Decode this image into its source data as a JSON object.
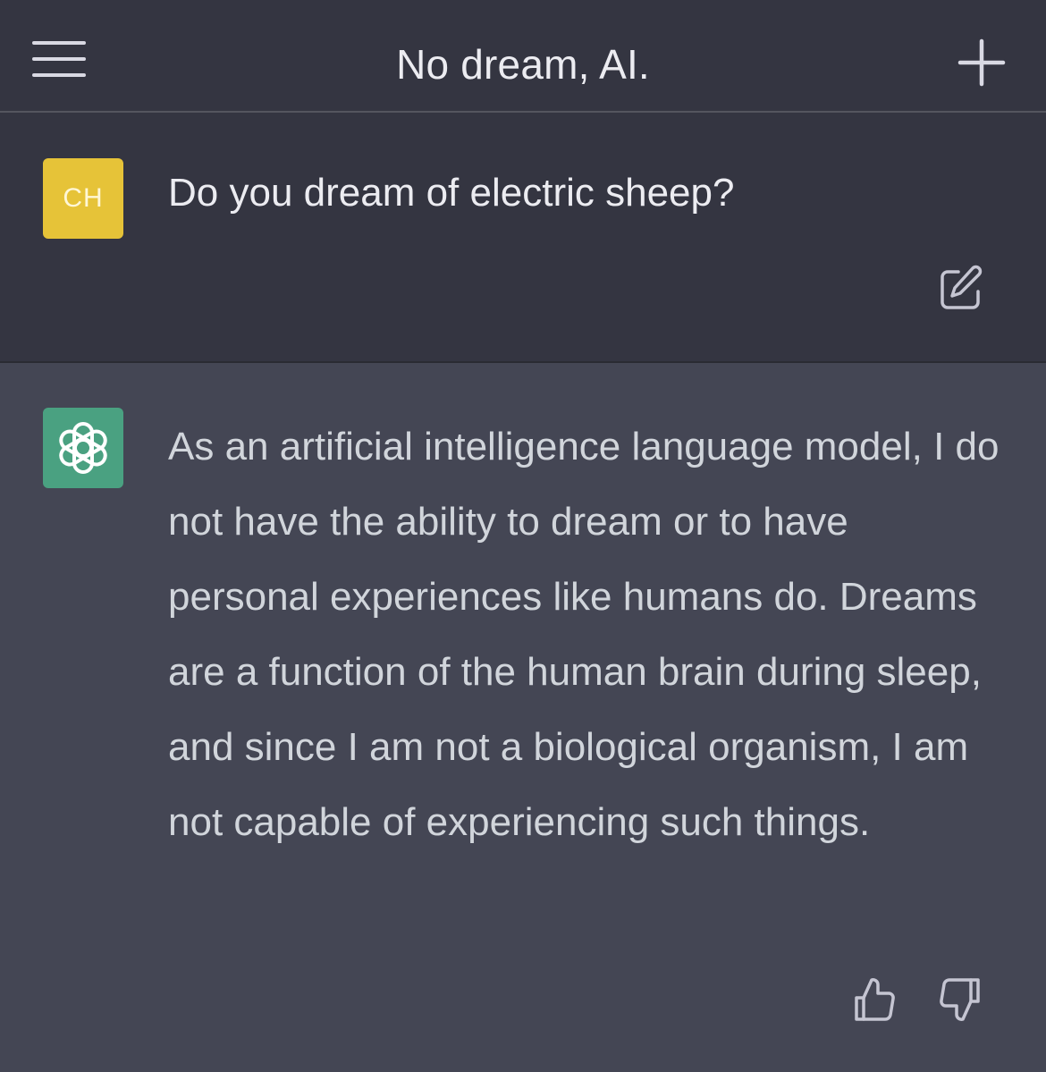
{
  "header": {
    "title": "No dream, AI.",
    "menu_icon": "hamburger-menu-icon",
    "new_chat_icon": "plus-icon"
  },
  "user_message": {
    "avatar_initials": "CH",
    "avatar_color": "#e6c338",
    "text": "Do you dream of electric sheep?",
    "edit_icon": "edit-icon"
  },
  "assistant_message": {
    "avatar_icon": "openai-logo-icon",
    "avatar_color": "#4aa181",
    "text": "As an artificial intelligence language model, I do not have the ability to dream or to have personal experiences like humans do. Dreams are a function of the human brain during sleep, and since I am not a biological organism, I am not capable of experiencing such things.",
    "feedback": {
      "thumbs_up_icon": "thumbs-up-icon",
      "thumbs_down_icon": "thumbs-down-icon"
    }
  },
  "colors": {
    "header_bg": "#343541",
    "user_bg": "#343541",
    "assistant_bg": "#444654",
    "text_primary": "#ececf1",
    "text_assistant": "#d1d5db"
  }
}
